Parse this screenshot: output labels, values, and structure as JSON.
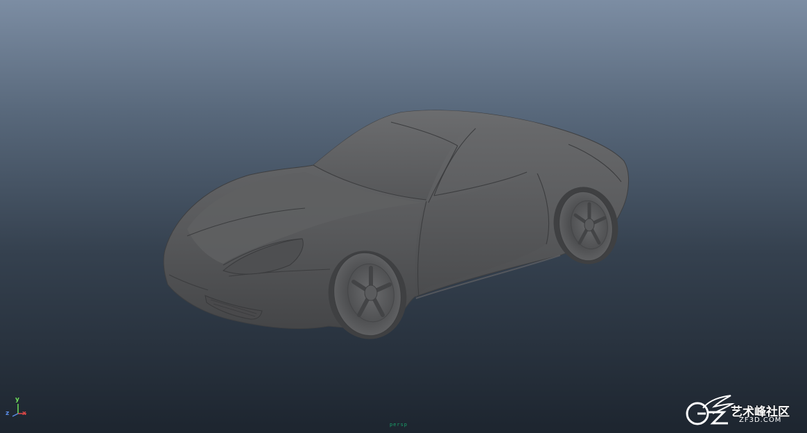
{
  "viewport": {
    "camera_name": "persp",
    "background_top": "#7c8da3",
    "background_bottom": "#1d252f"
  },
  "model": {
    "object": "car-sports-coupe",
    "shading": "smooth-shaded-gray",
    "body_color": "#58595b"
  },
  "axis_gizmo": {
    "y": "y",
    "x": "x",
    "z": "z"
  },
  "watermark": {
    "title": "艺术峰社区",
    "url": "ZF3D.COM"
  }
}
